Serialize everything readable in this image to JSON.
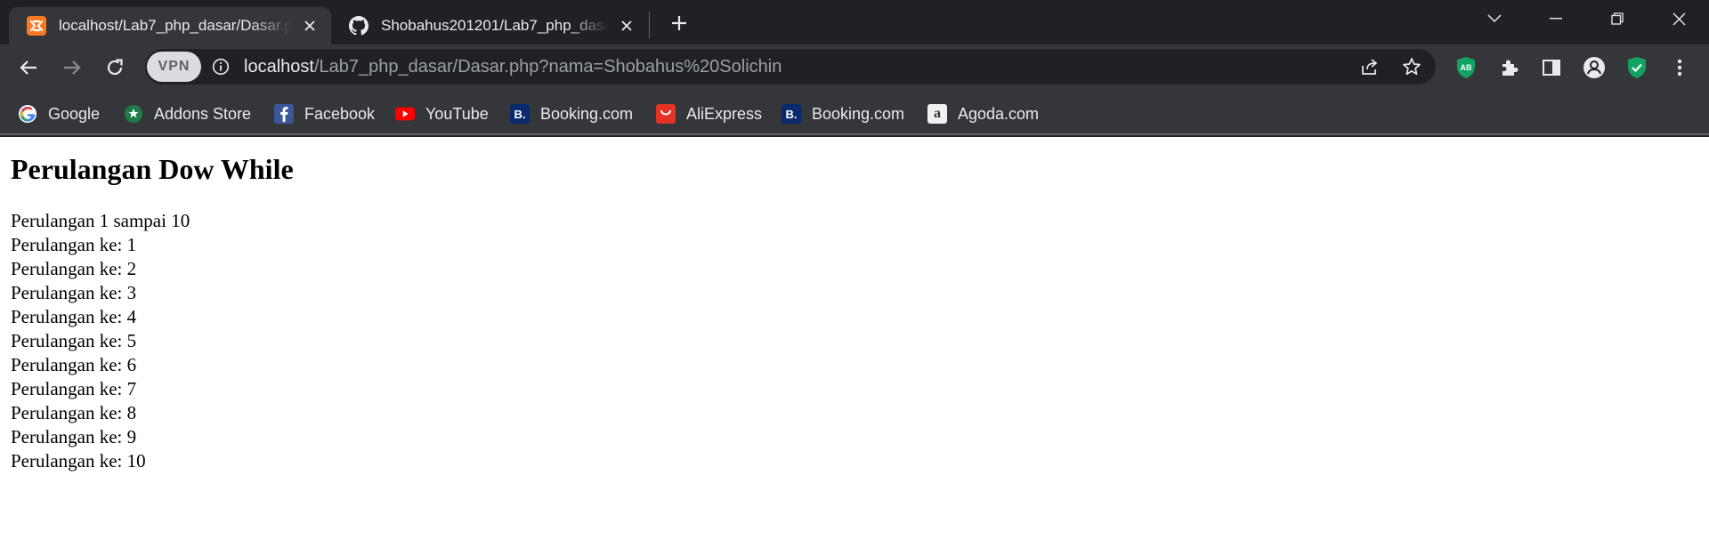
{
  "browser": {
    "tabs": [
      {
        "title": "localhost/Lab7_php_dasar/Dasar.php?nama=Shobahus%20Solichin",
        "favicon": "xampp-icon",
        "active": true
      },
      {
        "title": "Shobahus201201/Lab7_php_dasar",
        "favicon": "github-icon",
        "active": false
      }
    ],
    "address": {
      "host": "localhost",
      "path": "/Lab7_php_dasar/Dasar.php?nama=Shobahus%20Solichin",
      "vpn_label": "VPN"
    },
    "extensions": {
      "adblock_label": "AB"
    },
    "bookmarks": [
      {
        "label": "Google",
        "icon": "google-icon"
      },
      {
        "label": "Addons Store",
        "icon": "addons-store-icon"
      },
      {
        "label": "Facebook",
        "icon": "facebook-icon"
      },
      {
        "label": "YouTube",
        "icon": "youtube-icon"
      },
      {
        "label": "Booking.com",
        "icon": "booking-icon"
      },
      {
        "label": "AliExpress",
        "icon": "aliexpress-icon"
      },
      {
        "label": "Booking.com",
        "icon": "booking-icon"
      },
      {
        "label": "Agoda.com",
        "icon": "agoda-icon"
      }
    ],
    "colors": {
      "frame": "#202124",
      "toolbar": "#35363a",
      "text": "#e8eaed"
    }
  },
  "page": {
    "heading": "Perulangan Dow While",
    "intro": "Perulangan 1 sampai 10",
    "lines": [
      "Perulangan ke: 1",
      "Perulangan ke: 2",
      "Perulangan ke: 3",
      "Perulangan ke: 4",
      "Perulangan ke: 5",
      "Perulangan ke: 6",
      "Perulangan ke: 7",
      "Perulangan ke: 8",
      "Perulangan ke: 9",
      "Perulangan ke: 10"
    ]
  }
}
